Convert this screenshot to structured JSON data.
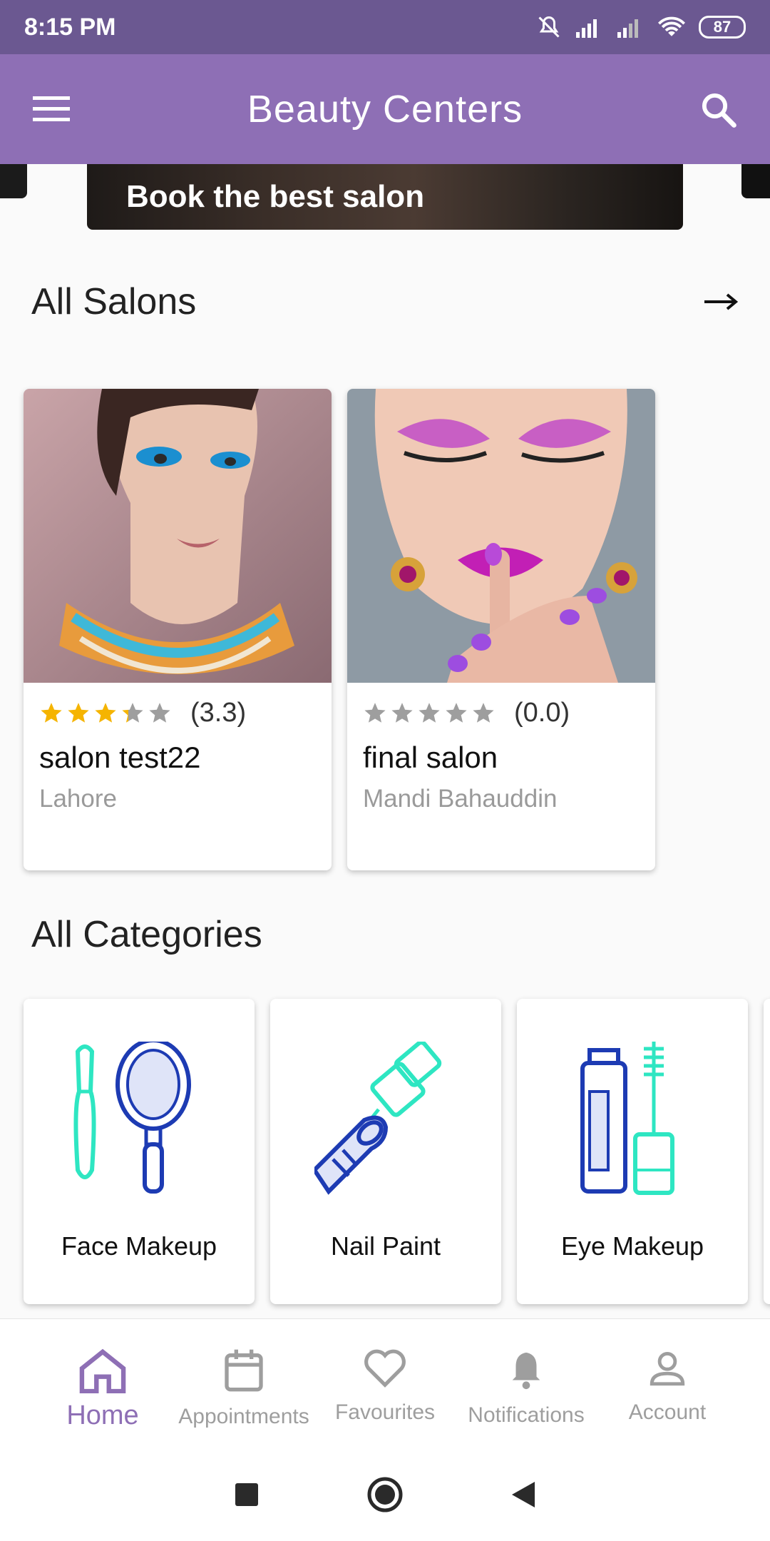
{
  "status_bar": {
    "time": "8:15 PM",
    "battery": "87"
  },
  "app_bar": {
    "title": "Beauty Centers",
    "menu_icon": "hamburger-menu-icon",
    "search_icon": "search-icon"
  },
  "banner": {
    "caption": "Book the best salon"
  },
  "salons_section": {
    "title": "All Salons",
    "more_icon": "arrow-right-icon"
  },
  "salons": [
    {
      "rating_text": "(3.3)",
      "rating": 3.3,
      "name": "salon test22",
      "city": "Lahore"
    },
    {
      "rating_text": "(0.0)",
      "rating": 0.0,
      "name": "final salon",
      "city": "Mandi Bahauddin"
    }
  ],
  "categories_section": {
    "title": "All Categories"
  },
  "categories": [
    {
      "label": "Face Makeup",
      "icon": "makeup-brush-mirror-icon"
    },
    {
      "label": "Nail Paint",
      "icon": "nail-polish-icon"
    },
    {
      "label": "Eye Makeup",
      "icon": "mascara-icon"
    }
  ],
  "bottom_nav": [
    {
      "label": "Home",
      "icon": "home-icon",
      "active": true
    },
    {
      "label": "Appointments",
      "icon": "calendar-icon",
      "active": false
    },
    {
      "label": "Favourites",
      "icon": "heart-icon",
      "active": false
    },
    {
      "label": "Notifications",
      "icon": "bell-icon",
      "active": false
    },
    {
      "label": "Account",
      "icon": "person-icon",
      "active": false
    }
  ],
  "colors": {
    "primary": "#8e6fb5",
    "status_bar": "#6b5891",
    "star": "#f5b400",
    "teal": "#2ee6c2",
    "blue": "#1d3bb3"
  }
}
